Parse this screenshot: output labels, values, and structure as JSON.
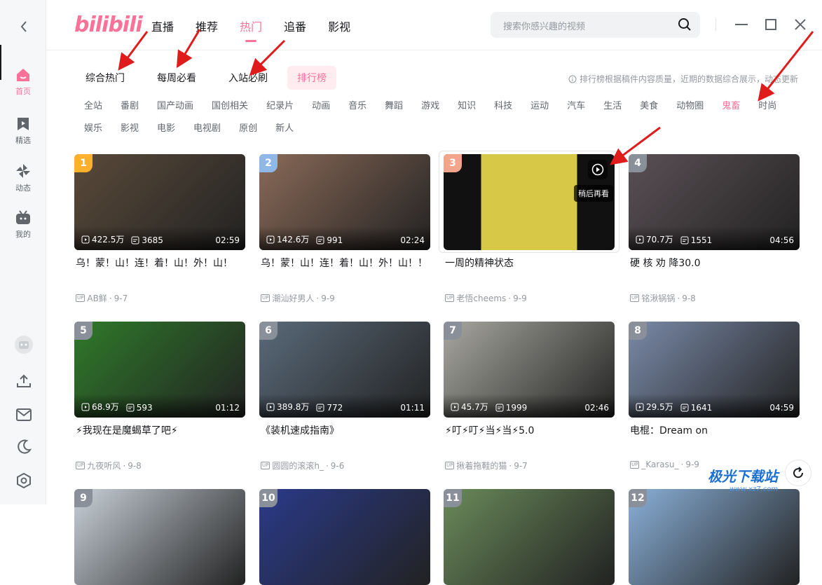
{
  "app": {
    "logo": "bilibili"
  },
  "sidebar": {
    "items": [
      {
        "label": "首页",
        "icon": "home-icon",
        "active": true
      },
      {
        "label": "精选",
        "icon": "bookmark-icon"
      },
      {
        "label": "动态",
        "icon": "pinwheel-icon"
      },
      {
        "label": "我的",
        "icon": "tv-icon"
      }
    ],
    "bottom_icons": [
      "avatar-icon",
      "upload-icon",
      "mail-icon",
      "moon-icon",
      "settings-icon"
    ]
  },
  "header": {
    "nav": [
      "直播",
      "推荐",
      "热门",
      "追番",
      "影视"
    ],
    "active_nav": "热门",
    "search_placeholder": "搜索你感兴趣的视频"
  },
  "tabs": [
    "综合热门",
    "每周必看",
    "入站必刷",
    "排行榜"
  ],
  "active_tab": "排行榜",
  "ranking_info": "排行榜根据稿件内容质量，近期的数据综合展示，动态更新",
  "categories": [
    "全站",
    "番剧",
    "国产动画",
    "国创相关",
    "纪录片",
    "动画",
    "音乐",
    "舞蹈",
    "游戏",
    "知识",
    "科技",
    "运动",
    "汽车",
    "生活",
    "美食",
    "动物圈",
    "鬼畜",
    "时尚",
    "娱乐",
    "影视",
    "电影",
    "电视剧",
    "原创",
    "新人"
  ],
  "active_category": "鬼畜",
  "watch_later_tooltip": "稍后再看",
  "videos": [
    {
      "rank": "1",
      "views": "422.5万",
      "danmaku": "3685",
      "duration": "02:59",
      "title": "乌！蒙！山！连！着！山！外！山！",
      "uploader": "AB鲜",
      "date": "9-7",
      "color": "#5a4a3a"
    },
    {
      "rank": "2",
      "views": "142.6万",
      "danmaku": "991",
      "duration": "02:24",
      "title": "乌！蒙！山！连！着！山！外！山！！",
      "uploader": "潮汕好男人",
      "date": "9-9",
      "color": "#8a6a58"
    },
    {
      "rank": "3",
      "views": "",
      "danmaku": "",
      "duration": "",
      "title": "一周的精神状态",
      "uploader": "老悟cheems",
      "date": "9-9",
      "color": "#d8c848"
    },
    {
      "rank": "4",
      "views": "70.7万",
      "danmaku": "1551",
      "duration": "04:56",
      "title": "硬 核 劝 降30.0",
      "uploader": "铭湫锅锅",
      "date": "9-8",
      "color": "#5a5055"
    },
    {
      "rank": "5",
      "views": "68.9万",
      "danmaku": "593",
      "duration": "01:12",
      "title": "⚡我现在是魔蝎草了吧⚡",
      "uploader": "九夜听风",
      "date": "9-8",
      "color": "#2f7a2a"
    },
    {
      "rank": "6",
      "views": "389.8万",
      "danmaku": "772",
      "duration": "01:11",
      "title": "《装机速成指南》",
      "uploader": "圆圆的滚滚h_",
      "date": "9-6",
      "color": "#5a6a7a"
    },
    {
      "rank": "7",
      "views": "45.7万",
      "danmaku": "1999",
      "duration": "02:46",
      "title": "⚡叮⚡叮⚡当⚡当⚡5.0",
      "uploader": "揪着拖鞋的猫",
      "date": "9-7",
      "color": "#a8a8a0"
    },
    {
      "rank": "8",
      "views": "29.5万",
      "danmaku": "1641",
      "duration": "04:59",
      "title": "电棍：Dream on",
      "uploader": "_Karasu_",
      "date": "9-9",
      "color": "#7a8aa8"
    },
    {
      "rank": "9",
      "color": "#c8d0d8"
    },
    {
      "rank": "10",
      "color": "#2a3a8a"
    },
    {
      "rank": "11",
      "color": "#6a8a5a"
    },
    {
      "rank": "12",
      "color": "#8ab0d8"
    }
  ],
  "watermark": {
    "line1": "极光下载站",
    "line2": "www.xz7.com"
  },
  "colors": {
    "accent": "#fb7299",
    "rank_top": "#fdb02c",
    "rank_2": "#8fb8e8",
    "rank_3": "#f2a58a",
    "rank_other": "#8a9099",
    "arrow": "#e01b1b"
  }
}
